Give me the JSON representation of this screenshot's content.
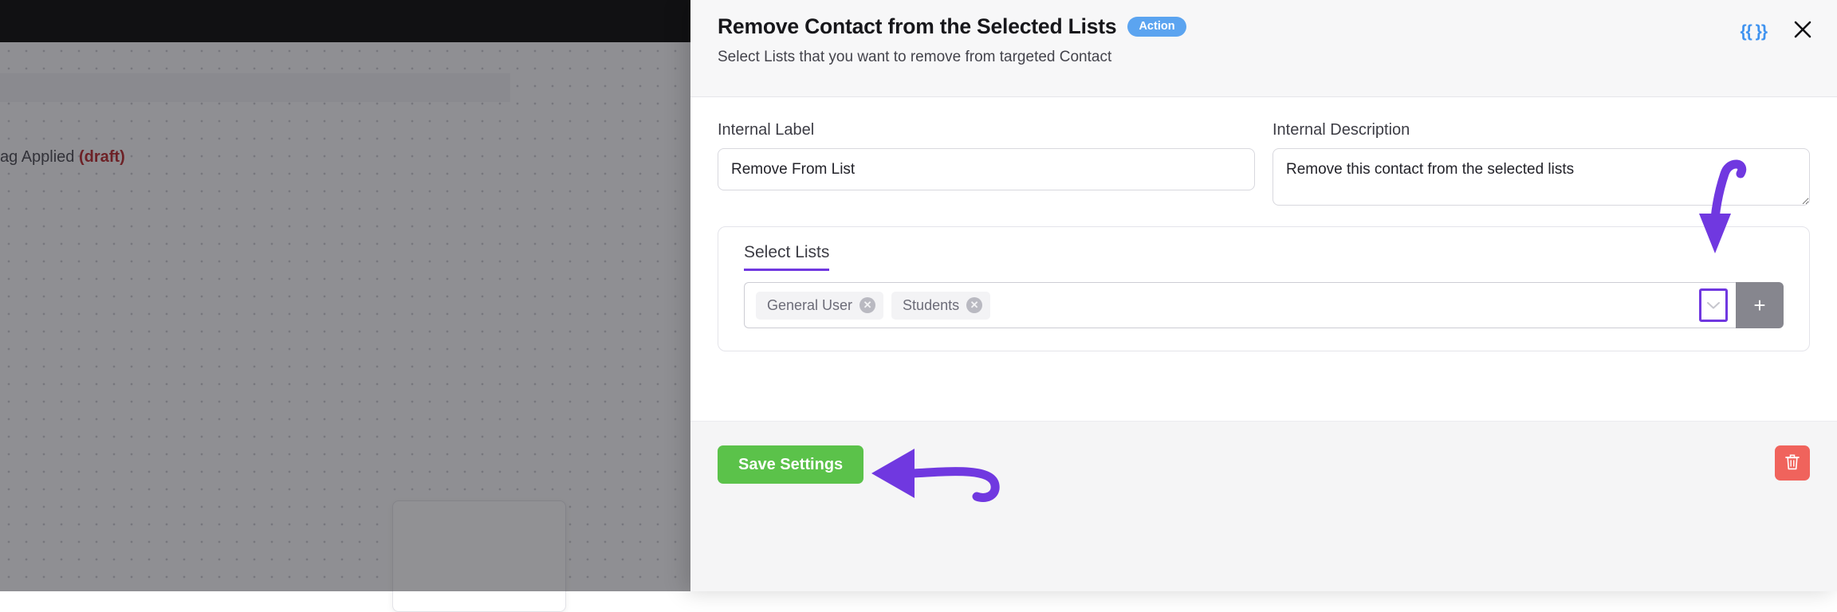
{
  "background": {
    "node_label": "ag Applied",
    "node_status": "(draft)"
  },
  "drawer": {
    "header": {
      "title": "Remove Contact from the Selected Lists",
      "badge": "Action",
      "subtitle": "Select Lists that you want to remove from targeted Contact",
      "merge_tags_icon": "{{ }}",
      "merge_tags_icon_name": "merge-tags-icon",
      "merge_tags_color": "#3f93f0",
      "close_icon_name": "close-icon",
      "badge_color": "#5ba4f0"
    },
    "fields": {
      "internal_label": {
        "label": "Internal Label",
        "value": "Remove From List",
        "placeholder": "Internal Label"
      },
      "internal_description": {
        "label": "Internal Description",
        "value": "Remove this contact from the selected lists",
        "placeholder": "Internal Description"
      }
    },
    "select_lists": {
      "tab_label": "Select Lists",
      "tab_accent_color": "#7038e0",
      "chips": [
        {
          "label": "General User",
          "remove_icon": "✕"
        },
        {
          "label": "Students",
          "remove_icon": "✕"
        }
      ],
      "dropdown_toggle_icon": "chevron-down-icon",
      "dropdown_toggle_highlight_color": "#7038e0",
      "add_button_label": "+",
      "add_button_color": "#86868e"
    },
    "footer": {
      "save_label": "Save Settings",
      "save_color": "#5bc24a",
      "delete_icon_name": "trash-icon",
      "delete_color": "#f0635c"
    }
  },
  "annotations": {
    "accent_color": "#7038e0",
    "arrow_to_dropdown": "curved-arrow-down",
    "arrow_to_save": "curved-arrow-left"
  }
}
